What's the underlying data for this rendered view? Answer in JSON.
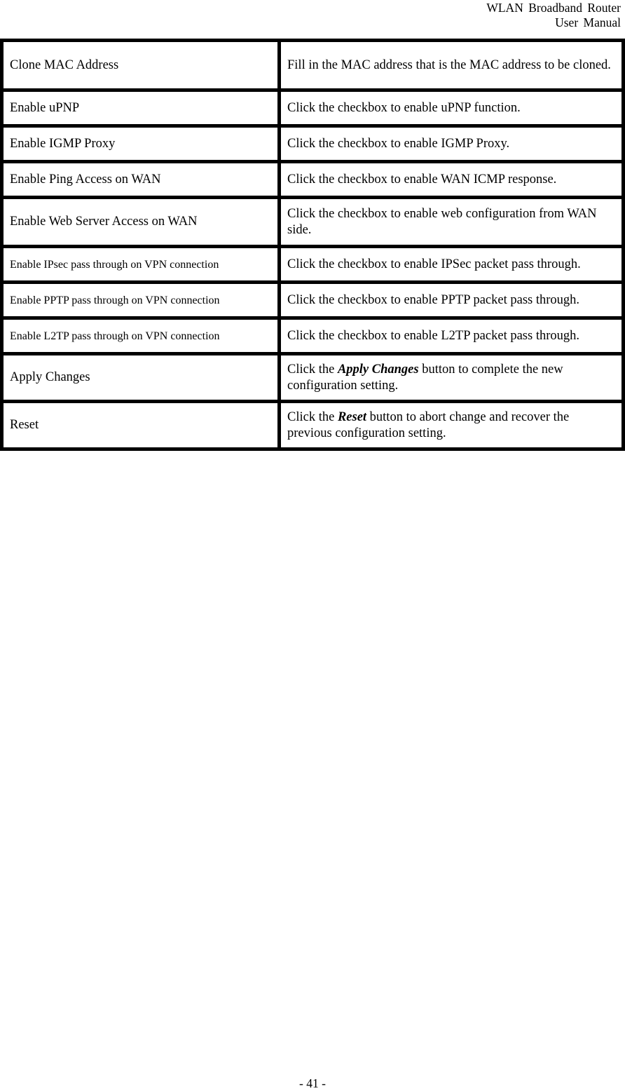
{
  "header": {
    "line1": "WLAN  Broadband  Router",
    "line2": "User  Manual"
  },
  "table": {
    "rows": [
      {
        "field": "Clone MAC Address",
        "description": "Fill in the MAC address that is the MAC address to be cloned."
      },
      {
        "field": "Enable uPNP",
        "description": "Click the checkbox to enable uPNP function."
      },
      {
        "field": "Enable IGMP Proxy",
        "description": "Click the checkbox to enable IGMP Proxy."
      },
      {
        "field": "Enable Ping Access on WAN",
        "description": "Click the checkbox to enable WAN ICMP response."
      },
      {
        "field": "Enable Web Server Access on WAN",
        "description": "Click the checkbox to enable web configuration from WAN side."
      },
      {
        "field": "Enable IPsec pass through on VPN connection",
        "description": "Click the checkbox to enable IPSec packet pass through."
      },
      {
        "field": "Enable PPTP pass through on VPN connection",
        "description": "Click the checkbox to enable PPTP packet pass through."
      },
      {
        "field": "Enable L2TP pass through on VPN connection",
        "description": "Click the checkbox to enable L2TP packet pass through."
      },
      {
        "field": "Apply Changes",
        "description_pre": "Click the ",
        "description_em": "Apply Changes",
        "description_post": " button to complete the new configuration setting."
      },
      {
        "field": "Reset",
        "description_pre": "Click the ",
        "description_em": "Reset",
        "description_post": " button to abort change and recover the previous configuration setting."
      }
    ]
  },
  "footer": {
    "page_number": "- 41 -"
  }
}
